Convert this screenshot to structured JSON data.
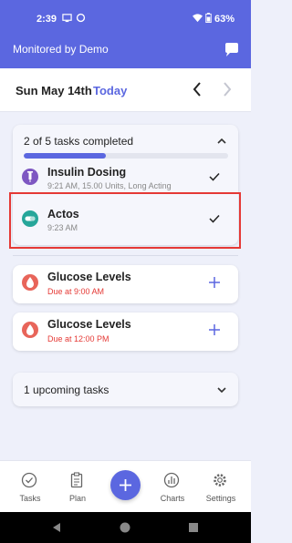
{
  "status_bar": {
    "time": "2:39",
    "battery": "63%"
  },
  "header": {
    "title": "Monitored by Demo",
    "chat_icon": "chat-bubble-icon"
  },
  "date_bar": {
    "date": "Sun May 14th",
    "today_label": "Today"
  },
  "task_group": {
    "summary": "2 of 5 tasks completed",
    "progress_fraction": 0.4,
    "tasks": [
      {
        "name": "Insulin Dosing",
        "detail": "9:21 AM, 15.00 Units, Long Acting",
        "icon": "syringe-icon",
        "icon_color": "#7e57c2"
      },
      {
        "name": "Actos",
        "detail": "9:23 AM",
        "icon": "pill-icon",
        "icon_color": "#26a69a"
      }
    ]
  },
  "due_tasks": [
    {
      "name": "Glucose Levels",
      "due": "Due at 9:00 AM",
      "icon": "blood-drop-icon"
    },
    {
      "name": "Glucose Levels",
      "due": "Due at 12:00 PM",
      "icon": "blood-drop-icon"
    }
  ],
  "upcoming": {
    "label": "1 upcoming tasks"
  },
  "bottom_nav": {
    "tasks": "Tasks",
    "plan": "Plan",
    "charts": "Charts",
    "settings": "Settings"
  },
  "colors": {
    "primary": "#5b67e0",
    "due": "#e53935",
    "highlight": "#e53935"
  }
}
